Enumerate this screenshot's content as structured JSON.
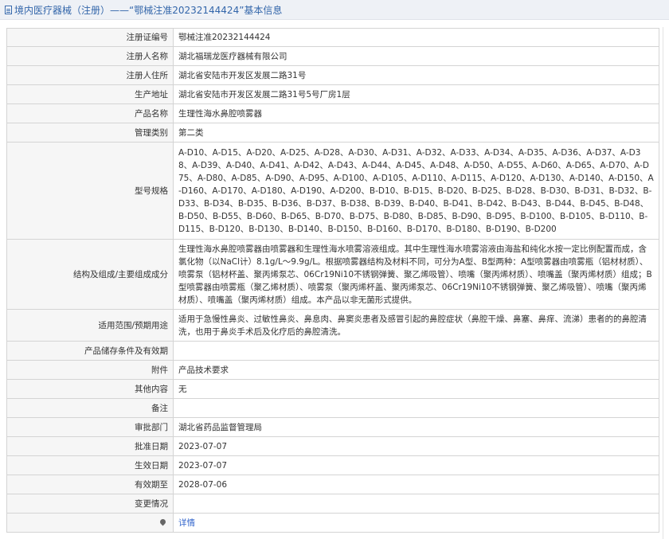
{
  "header": {
    "title": "境内医疗器械（注册）——“鄂械注准20232144424”基本信息"
  },
  "rows": {
    "reg_no": {
      "label": "注册证编号",
      "value": "鄂械注准20232144424"
    },
    "registrant": {
      "label": "注册人名称",
      "value": "湖北福瑞龙医疗器械有限公司"
    },
    "registrant_addr": {
      "label": "注册人住所",
      "value": "湖北省安陆市开发区发展二路31号"
    },
    "production_addr": {
      "label": "生产地址",
      "value": "湖北省安陆市开发区发展二路31号5号厂房1层"
    },
    "product_name": {
      "label": "产品名称",
      "value": "生理性海水鼻腔喷雾器"
    },
    "category": {
      "label": "管理类别",
      "value": "第二类"
    },
    "models": {
      "label": "型号规格",
      "value": "A-D10、A-D15、A-D20、A-D25、A-D28、A-D30、A-D31、A-D32、A-D33、A-D34、A-D35、A-D36、A-D37、A-D38、A-D39、A-D40、A-D41、A-D42、A-D43、A-D44、A-D45、A-D48、A-D50、A-D55、A-D60、A-D65、A-D70、A-D75、A-D80、A-D85、A-D90、A-D95、A-D100、A-D105、A-D110、A-D115、A-D120、A-D130、A-D140、A-D150、A-D160、A-D170、A-D180、A-D190、A-D200、B-D10、B-D15、B-D20、B-D25、B-D28、B-D30、B-D31、B-D32、B-D33、B-D34、B-D35、B-D36、B-D37、B-D38、B-D39、B-D40、B-D41、B-D42、B-D43、B-D44、B-D45、B-D48、B-D50、B-D55、B-D60、B-D65、B-D70、B-D75、B-D80、B-D85、B-D90、B-D95、B-D100、B-D105、B-D110、B-D115、B-D120、B-D130、B-D140、B-D150、B-D160、B-D170、B-D180、B-D190、B-D200"
    },
    "structure": {
      "label": "结构及组成/主要组成成分",
      "value": "生理性海水鼻腔喷雾器由喷雾器和生理性海水喷雾溶液组成。其中生理性海水喷雾溶液由海盐和纯化水按一定比例配置而成，含氯化物（以NaCl计）8.1g/L～9.9g/L。根据喷雾器结构及材料不同，可分为A型、B型两种：A型喷雾器由喷雾瓶（铝材材质）、喷雾泵（铝材杯盖、聚丙烯泵芯、06Cr19Ni10不锈钢弹簧、聚乙烯吸管）、喷嘴（聚丙烯材质）、喷嘴盖（聚丙烯材质）组成；B型喷雾器由喷雾瓶（聚乙烯材质）、喷雾泵（聚丙烯杯盖、聚丙烯泵芯、06Cr19Ni10不锈钢弹簧、聚乙烯吸管）、喷嘴（聚丙烯材质）、喷嘴盖（聚丙烯材质）组成。本产品以非无菌形式提供。"
    },
    "scope": {
      "label": "适用范围/预期用途",
      "value": "适用于急慢性鼻炎、过敏性鼻炎、鼻息肉、鼻窦炎患者及感冒引起的鼻腔症状（鼻腔干燥、鼻塞、鼻痒、流涕）患者的的鼻腔清洗，也用于鼻炎手术后及化疗后的鼻腔清洗。"
    },
    "storage": {
      "label": "产品储存条件及有效期",
      "value": ""
    },
    "attachment": {
      "label": "附件",
      "value": "产品技术要求"
    },
    "other": {
      "label": "其他内容",
      "value": "无"
    },
    "remark": {
      "label": "备注",
      "value": ""
    },
    "approval_dept": {
      "label": "审批部门",
      "value": "湖北省药品监督管理局"
    },
    "approval_date": {
      "label": "批准日期",
      "value": "2023-07-07"
    },
    "effective_date": {
      "label": "生效日期",
      "value": "2023-07-07"
    },
    "expiry_date": {
      "label": "有效期至",
      "value": "2028-07-06"
    },
    "change": {
      "label": "变更情况",
      "value": ""
    },
    "detail": {
      "label": "",
      "link": "详情"
    }
  }
}
